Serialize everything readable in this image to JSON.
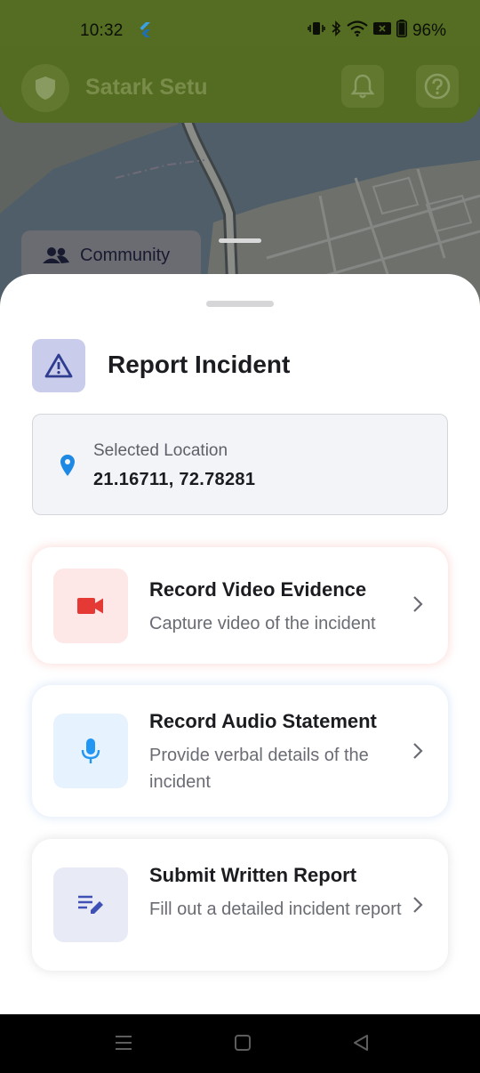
{
  "status_bar": {
    "time": "10:32",
    "battery": "96%",
    "icons": [
      "flutter-icon",
      "vibrate-icon",
      "bluetooth-icon",
      "wifi-icon",
      "x-badge-icon",
      "battery-icon"
    ]
  },
  "app_bar": {
    "title": "Satark Setu",
    "icons": [
      "shield-icon",
      "bell-icon",
      "help-icon"
    ]
  },
  "map": {
    "chip_label": "Community",
    "chip_icon": "people-icon"
  },
  "sheet": {
    "title": "Report Incident",
    "title_icon": "warning-icon",
    "location": {
      "label": "Selected Location",
      "value": "21.16711, 72.78281",
      "icon": "location-pin-icon"
    },
    "options": [
      {
        "title": "Record Video Evidence",
        "description": "Capture video of the incident",
        "icon": "videocam-icon",
        "accent": "#e53935",
        "icon_bg": "#fde8e7"
      },
      {
        "title": "Record Audio Statement",
        "description": "Provide verbal details of the incident",
        "icon": "mic-icon",
        "accent": "#2196f3",
        "icon_bg": "#e6f2fd"
      },
      {
        "title": "Submit Written Report",
        "description": "Fill out a detailed incident report",
        "icon": "edit-note-icon",
        "accent": "#3f51b5",
        "icon_bg": "#e8eaf6"
      }
    ]
  },
  "nav_bar": {
    "buttons": [
      "menu-icon",
      "home-icon",
      "back-icon"
    ]
  },
  "colors": {
    "app_bar": "#546c22",
    "sheet": "#ffffff",
    "header_icon_bg": "#c9cdeb"
  }
}
